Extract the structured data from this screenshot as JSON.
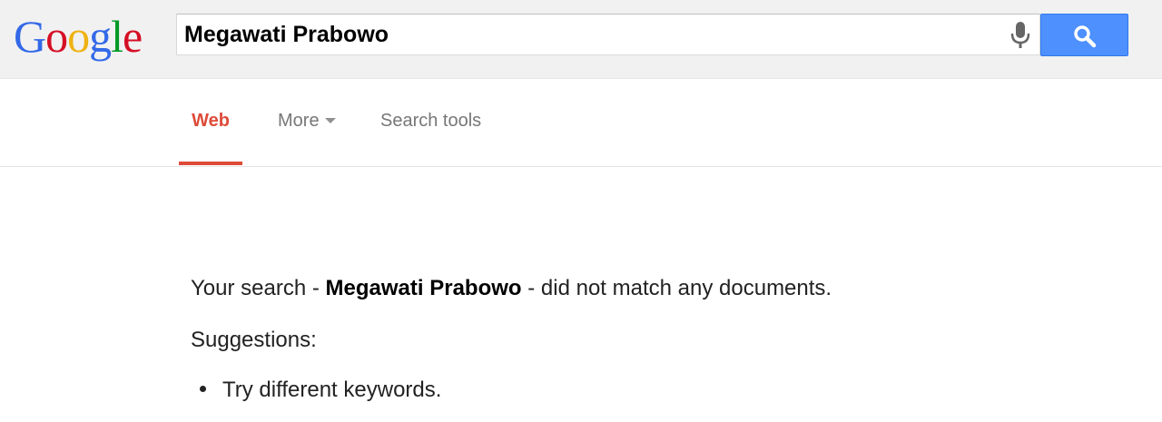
{
  "logo": {
    "letters": [
      "G",
      "o",
      "o",
      "g",
      "l",
      "e"
    ],
    "colors": [
      "#3369e8",
      "#d50f25",
      "#eeb211",
      "#3369e8",
      "#009925",
      "#d50f25"
    ]
  },
  "search": {
    "query": "Megawati Prabowo",
    "mic_icon": "microphone-icon",
    "button_icon": "magnifier-icon"
  },
  "tabs": {
    "web": "Web",
    "more": "More",
    "search_tools": "Search tools"
  },
  "results": {
    "prefix": "Your search - ",
    "query": "Megawati Prabowo",
    "suffix": " - did not match any documents.",
    "suggestions_title": "Suggestions:",
    "suggestions": [
      "Try different keywords."
    ]
  },
  "colors": {
    "active_tab": "#dd4b39",
    "search_button": "#4d90fe",
    "header_bg": "#f1f1f1"
  }
}
